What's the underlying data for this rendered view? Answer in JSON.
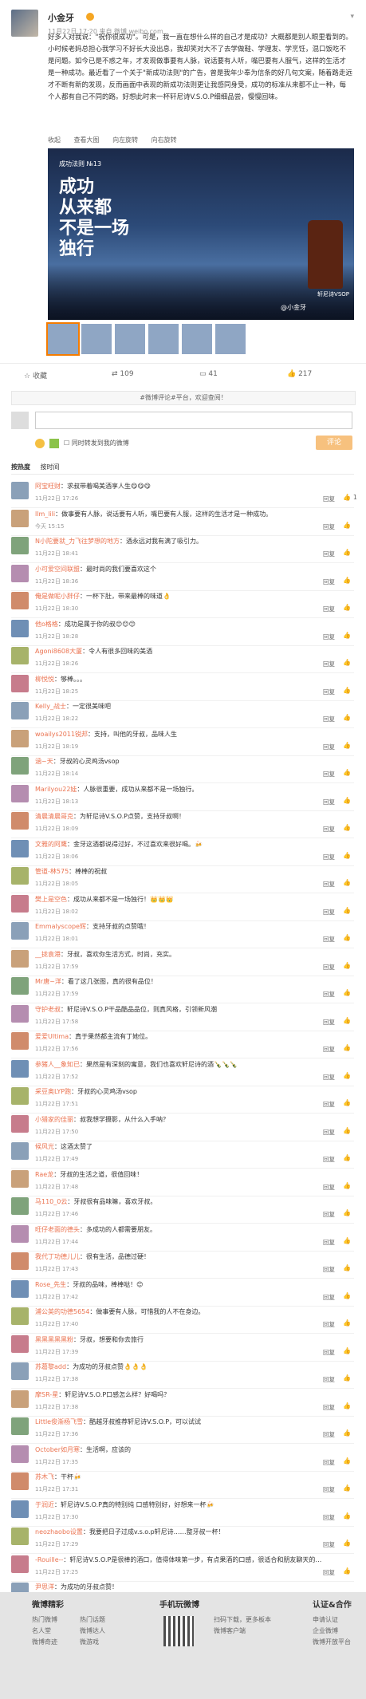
{
  "post": {
    "author": "小金牙",
    "meta": "11月22日 17:20 来自 微博 weibo.com",
    "text": "好多人对我说：\"祝你很成功\"。可是，我一直在想什么样的自己才是成功？大概都是别人眼里看到的。小时候老妈总担心我学习不好长大没出息，我却笑对大不了去学做鞋、学理发、学烹饪，混口饭吃不是问题。如今已是不惑之年，才发现做事要有人脉，说话要有人听，嘴巴要有人服气，这样的生活才是一种成功。最近看了一个关于\"新成功法则\"的广告，曾是我年少奉为信条的好几句文案，随着路走远才不断有新的发现，反而画面中表现的新成功法则更让我感同身受，成功的标准从来都不止一种，每个人都有自己不同的路。好想此时来一杯轩尼诗V.S.O.P细细品尝，慢慢回味。",
    "mini_actions": [
      "收起",
      "查看大图",
      "向左旋转",
      "向右旋转"
    ],
    "image": {
      "tag": "成功法则 №13",
      "headline": [
        "成功",
        "从来都",
        "不是一场",
        "独行"
      ],
      "watermark": "@小金牙",
      "bottle_label": "轩尼诗VSOP"
    },
    "thumb_count": 6,
    "actions": {
      "collect": "收藏",
      "repost": "109",
      "comment": "41",
      "like": "217"
    }
  },
  "compose": {
    "notice": "#微博评论#平台，欢迎查阅！",
    "same_time": "同时转发到我的微博",
    "submit": "评论"
  },
  "sort": {
    "hot": "按热度",
    "time": "按时间"
  },
  "comments": [
    {
      "name": "阿宝旺财",
      "text": "求叔带着喝美酒享人生😋😋😋",
      "time": "11月22日 17:26",
      "likes": "1"
    },
    {
      "name": "llm_lili",
      "text": "做事要有人脉，说话要有人听，嘴巴要有人服，这样的生活才是一种成功。",
      "time": "今天 15:15",
      "likes": ""
    },
    {
      "name": "N小陀要就_力飞往梦想的地方",
      "text": "酒永远对我有满了吸引力。",
      "time": "11月22日 18:41",
      "likes": ""
    },
    {
      "name": "小可爱空间联盟",
      "text": "最时尚的我们要喜欢这个",
      "time": "11月22日 18:36",
      "likes": ""
    },
    {
      "name": "俺是做呢小胖仔",
      "text": "一杯下肚，带来最棒的味道👌",
      "time": "11月22日 18:30",
      "likes": ""
    },
    {
      "name": "他o格格",
      "text": "成功是属于你的叔😊😊😊",
      "time": "11月22日 18:28",
      "likes": ""
    },
    {
      "name": "Agoni8608大厦",
      "text": "令人有很多回味的美酒",
      "time": "11月22日 18:26",
      "likes": ""
    },
    {
      "name": "柳悦悦",
      "text": "够棒。。。",
      "time": "11月22日 18:25",
      "likes": ""
    },
    {
      "name": "Kelly_战士",
      "text": "一定很美味吧",
      "time": "11月22日 18:22",
      "likes": ""
    },
    {
      "name": "woailys2011锐邦",
      "text": "支持，叫他的牙叔，品味人生",
      "time": "11月22日 18:19",
      "likes": ""
    },
    {
      "name": "涵~天",
      "text": "牙叔的心灵鸡汤vsop",
      "time": "11月22日 18:14",
      "likes": ""
    },
    {
      "name": "Marilyou22娃",
      "text": "人脉很重要，成功从来都不是一场独行。",
      "time": "11月22日 18:13",
      "likes": ""
    },
    {
      "name": "清晨清晨哥克",
      "text": "为轩尼诗V.S.O.P点赞，支持牙叔啊！",
      "time": "11月22日 18:09",
      "likes": ""
    },
    {
      "name": "文雅的阿鹰",
      "text": "金牙这酒都说得过好，不过喜欢来很好喝。🍻",
      "time": "11月22日 18:06",
      "likes": ""
    },
    {
      "name": "管道-林575",
      "text": "棒棒的祝叔",
      "time": "11月22日 18:05",
      "likes": ""
    },
    {
      "name": "樊上是空色",
      "text": "成功从来都不是一场独行！👑👑👑",
      "time": "11月22日 18:02",
      "likes": ""
    },
    {
      "name": "Emmalyscope辉",
      "text": "支持牙叔的点赞哦！",
      "time": "11月22日 18:01",
      "likes": ""
    },
    {
      "name": "__拢袁港",
      "text": "牙叔，喜欢你生活方式，时尚，充实。",
      "time": "11月22日 17:59",
      "likes": ""
    },
    {
      "name": "Mr唐~洋",
      "text": "看了这几张图，真的很有品位！",
      "time": "11月22日 17:59",
      "likes": ""
    },
    {
      "name": "守护老叔",
      "text": "轩尼诗V.S.O.P干品酷品品位，则真风格，引领新风潮",
      "time": "11月22日 17:58",
      "likes": ""
    },
    {
      "name": "爱爱Ultima",
      "text": "真于果然都主流有丁她位。",
      "time": "11月22日 17:56",
      "likes": ""
    },
    {
      "name": "参猪人__象知已",
      "text": "果然是有深刻的寓意，我们也喜欢轩尼诗的酒🍾🍾🍾",
      "time": "11月22日 17:52",
      "likes": ""
    },
    {
      "name": "采豆奥LYP跑",
      "text": "牙叔的心灵鸡汤vsop",
      "time": "11月22日 17:51",
      "likes": ""
    },
    {
      "name": "小猎家的佳丽",
      "text": "叔我想学摄影，从什么入手呐？",
      "time": "11月22日 17:50",
      "likes": ""
    },
    {
      "name": "候风光",
      "text": "这酒太赞了",
      "time": "11月22日 17:49",
      "likes": ""
    },
    {
      "name": "Rae龙",
      "text": "牙叔的生活之道，很值回味！",
      "time": "11月22日 17:48",
      "likes": ""
    },
    {
      "name": "马110_0云",
      "text": "牙叔很有品味嘛，喜欢牙叔。",
      "time": "11月22日 17:46",
      "likes": ""
    },
    {
      "name": "旺仔老面的德头",
      "text": "多成功的人都需要朋友。",
      "time": "11月22日 17:44",
      "likes": ""
    },
    {
      "name": "我代丁功德儿儿",
      "text": "很有生活，品德过硬！",
      "time": "11月22日 17:43",
      "likes": ""
    },
    {
      "name": "Rose_先生",
      "text": "牙叔的品味，棒棒哒！😊",
      "time": "11月22日 17:42",
      "likes": ""
    },
    {
      "name": "浦公英的功德5654",
      "text": "做事要有人脉，可惜我的人不在身边。",
      "time": "11月22日 17:40",
      "likes": ""
    },
    {
      "name": "黑黑黑黑黑粉",
      "text": "牙叔，想要和你去旅行",
      "time": "11月22日 17:39",
      "likes": ""
    },
    {
      "name": "苏葛黎add",
      "text": "为成功的牙叔点赞👌👌👌",
      "time": "11月22日 17:38",
      "likes": ""
    },
    {
      "name": "摩SR-星",
      "text": "轩尼诗V.S.O.P口感怎么样？好喝吗？",
      "time": "11月22日 17:38",
      "likes": ""
    },
    {
      "name": "Little俊渐杨飞雪",
      "text": "酷越牙叔推荐轩尼诗V.S.O.P，可以试试",
      "time": "11月22日 17:36",
      "likes": ""
    },
    {
      "name": "October如月寒",
      "text": "生活啊，应该的",
      "time": "11月22日 17:35",
      "likes": ""
    },
    {
      "name": "苏木飞",
      "text": "干杯🍻",
      "time": "11月22日 17:31",
      "likes": ""
    },
    {
      "name": "于润近",
      "text": "轩尼诗V.S.O.P真的特别纯 口感特别好，好想来一杯🍻",
      "time": "11月22日 17:30",
      "likes": ""
    },
    {
      "name": "neozhaobo设置",
      "text": "我要把日子过成v.s.o.p轩尼诗……整牙叔一杯！",
      "time": "11月22日 17:29",
      "likes": ""
    },
    {
      "name": "-Rouille--",
      "text": "轩尼诗V.S.O.P是很棒的酒口，值得体味第一步，有点果酒的口感，很适合和朋友聊天的时候一起品味",
      "time": "11月22日 17:25",
      "likes": ""
    },
    {
      "name": "尹思洋",
      "text": "为成功的牙叔点赞！",
      "time": "11月22日 17:24",
      "likes": ""
    }
  ],
  "colors": {
    "accent": "#eb7350",
    "submit": "#f7c17e",
    "link": "#eb7350"
  },
  "footer": {
    "col1_title": "微博精彩",
    "col1_items": [
      "热门微博",
      "热门话题",
      "名人堂",
      "微博达人",
      "微博奇迹",
      "微游戏"
    ],
    "col2_title": "手机玩微博",
    "col2_items": [
      "扫码下载，更多板本",
      "微博客户端"
    ],
    "col3_title": "认证&合作",
    "col3_items": [
      "申请认证",
      "企业微博",
      "微博开放平台"
    ]
  }
}
